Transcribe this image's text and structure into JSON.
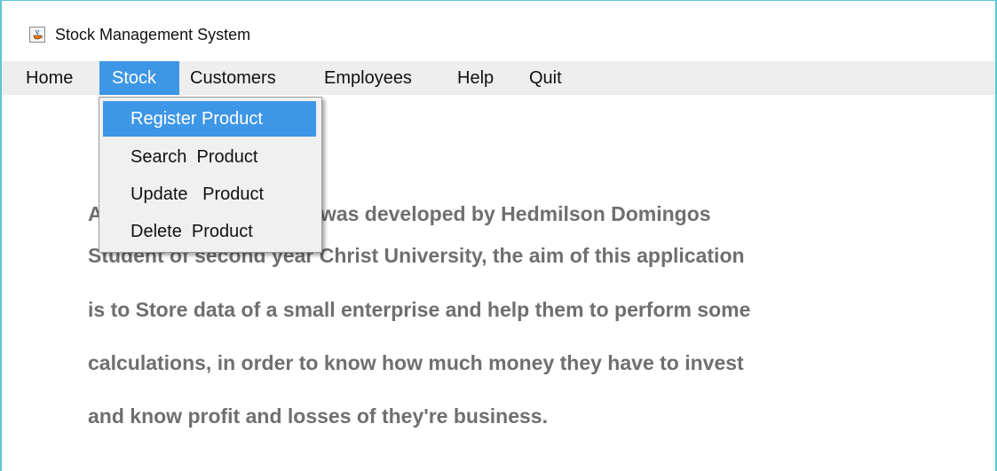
{
  "window": {
    "title": "Stock Management System",
    "icon": "java-cup-icon"
  },
  "menubar": {
    "items": [
      {
        "label": "Home"
      },
      {
        "label": "Stock"
      },
      {
        "label": "Customers"
      },
      {
        "label": "Employees"
      },
      {
        "label": "Help"
      },
      {
        "label": "Quit"
      }
    ],
    "active": "Stock"
  },
  "stock_menu": {
    "items": [
      {
        "label": "Register Product"
      },
      {
        "label": "Search  Product"
      },
      {
        "label": "Update   Product"
      },
      {
        "label": "Delete  Product"
      }
    ],
    "highlighted": "Register Product"
  },
  "content": {
    "lines": [
      "About: This application was developed by Hedmilson Domingos",
      "Student of second year Christ University, the aim of this application",
      "is to Store data of a small enterprise and help them to perform some",
      "calculations, in order to know how much money they have to invest",
      "and know profit and losses of they're business."
    ]
  },
  "colors": {
    "accent": "#3e96e6",
    "window_border": "#5bc8d9",
    "menubar_bg": "#eeeeee",
    "text_gray": "#6f6f6f"
  }
}
